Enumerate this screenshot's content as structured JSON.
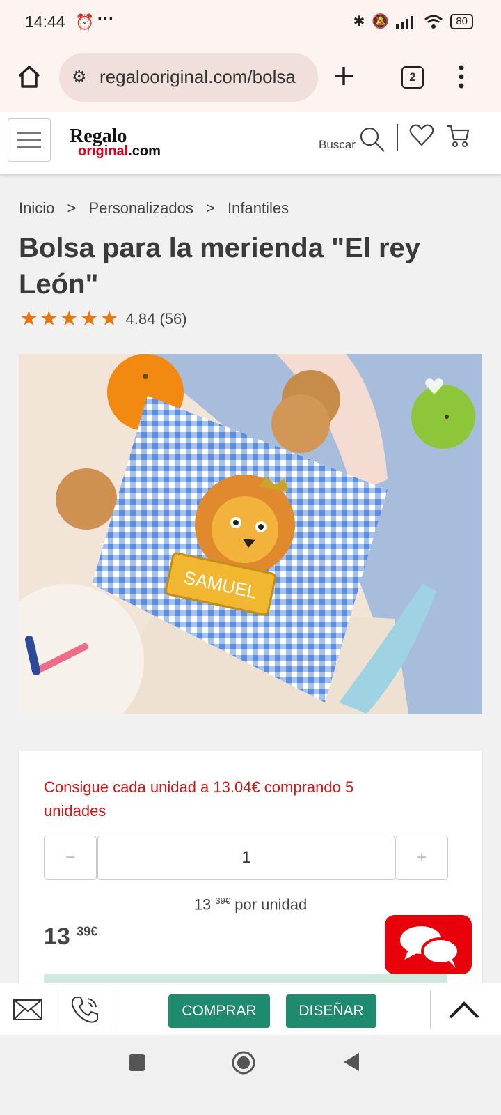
{
  "status_bar": {
    "time": "14:44",
    "battery": "80"
  },
  "browser": {
    "url": "regalooriginal.com/bolsa",
    "tab_count": "2"
  },
  "site": {
    "logo_top": "Regalo",
    "logo_bottom_red": "original",
    "logo_bottom_dark": ".com",
    "search_label": "Buscar"
  },
  "breadcrumb": [
    {
      "label": "Inicio"
    },
    {
      "sep": ">"
    },
    {
      "label": "Personalizados"
    },
    {
      "sep": ">"
    },
    {
      "label": "Infantiles"
    }
  ],
  "product": {
    "title": "Bolsa para la merienda \"El rey León\"",
    "rating_value": "4.84",
    "rating_count": "(56)",
    "stars": 5,
    "image_name_plate": "SAMUEL"
  },
  "pricing": {
    "promo": "Consigue cada unidad a 13.04€ comprando 5 unidades",
    "quantity": "1",
    "minus": "−",
    "plus": "+",
    "unit_int": "13",
    "unit_dec": "39€",
    "unit_suffix": "por unidad",
    "total_int": "13",
    "total_dec": "39€",
    "buy_big": "COMPRAR"
  },
  "bottom_bar": {
    "buy": "COMPRAR",
    "design": "DISEÑAR"
  },
  "colors": {
    "accent_green": "#1e8a6e",
    "promo_red": "#d61414",
    "chat_red": "#e8000b",
    "star_orange": "#e47911"
  }
}
